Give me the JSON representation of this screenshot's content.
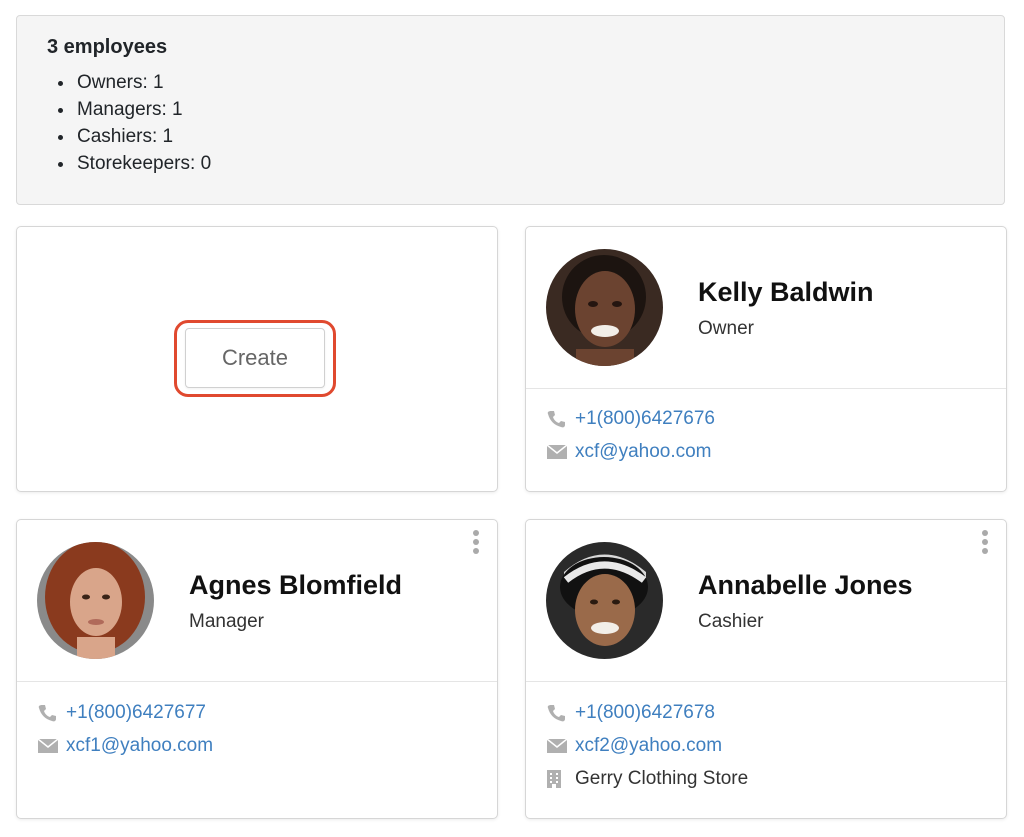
{
  "summary": {
    "title": "3 employees",
    "items": [
      "Owners: 1",
      "Managers: 1",
      "Cashiers: 1",
      "Storekeepers: 0"
    ]
  },
  "create": {
    "label": "Create",
    "highlight_color": "#e0492f"
  },
  "employees": [
    {
      "name": "Kelly Baldwin",
      "role": "Owner",
      "phone": "+1(800)6427676",
      "email": "xcf@yahoo.com"
    },
    {
      "name": "Agnes Blomfield",
      "role": "Manager",
      "phone": "+1(800)6427677",
      "email": "xcf1@yahoo.com"
    },
    {
      "name": "Annabelle Jones",
      "role": "Cashier",
      "phone": "+1(800)6427678",
      "email": "xcf2@yahoo.com",
      "store": "Gerry Clothing Store"
    }
  ],
  "colors": {
    "link": "#3f7fbf",
    "icon": "#b0b0b0",
    "card_border": "#d6d6d6",
    "summary_bg": "#f5f5f5"
  },
  "icons": {
    "phone": "phone-icon",
    "email": "envelope-icon",
    "store": "building-icon",
    "menu": "kebab-menu-icon"
  }
}
